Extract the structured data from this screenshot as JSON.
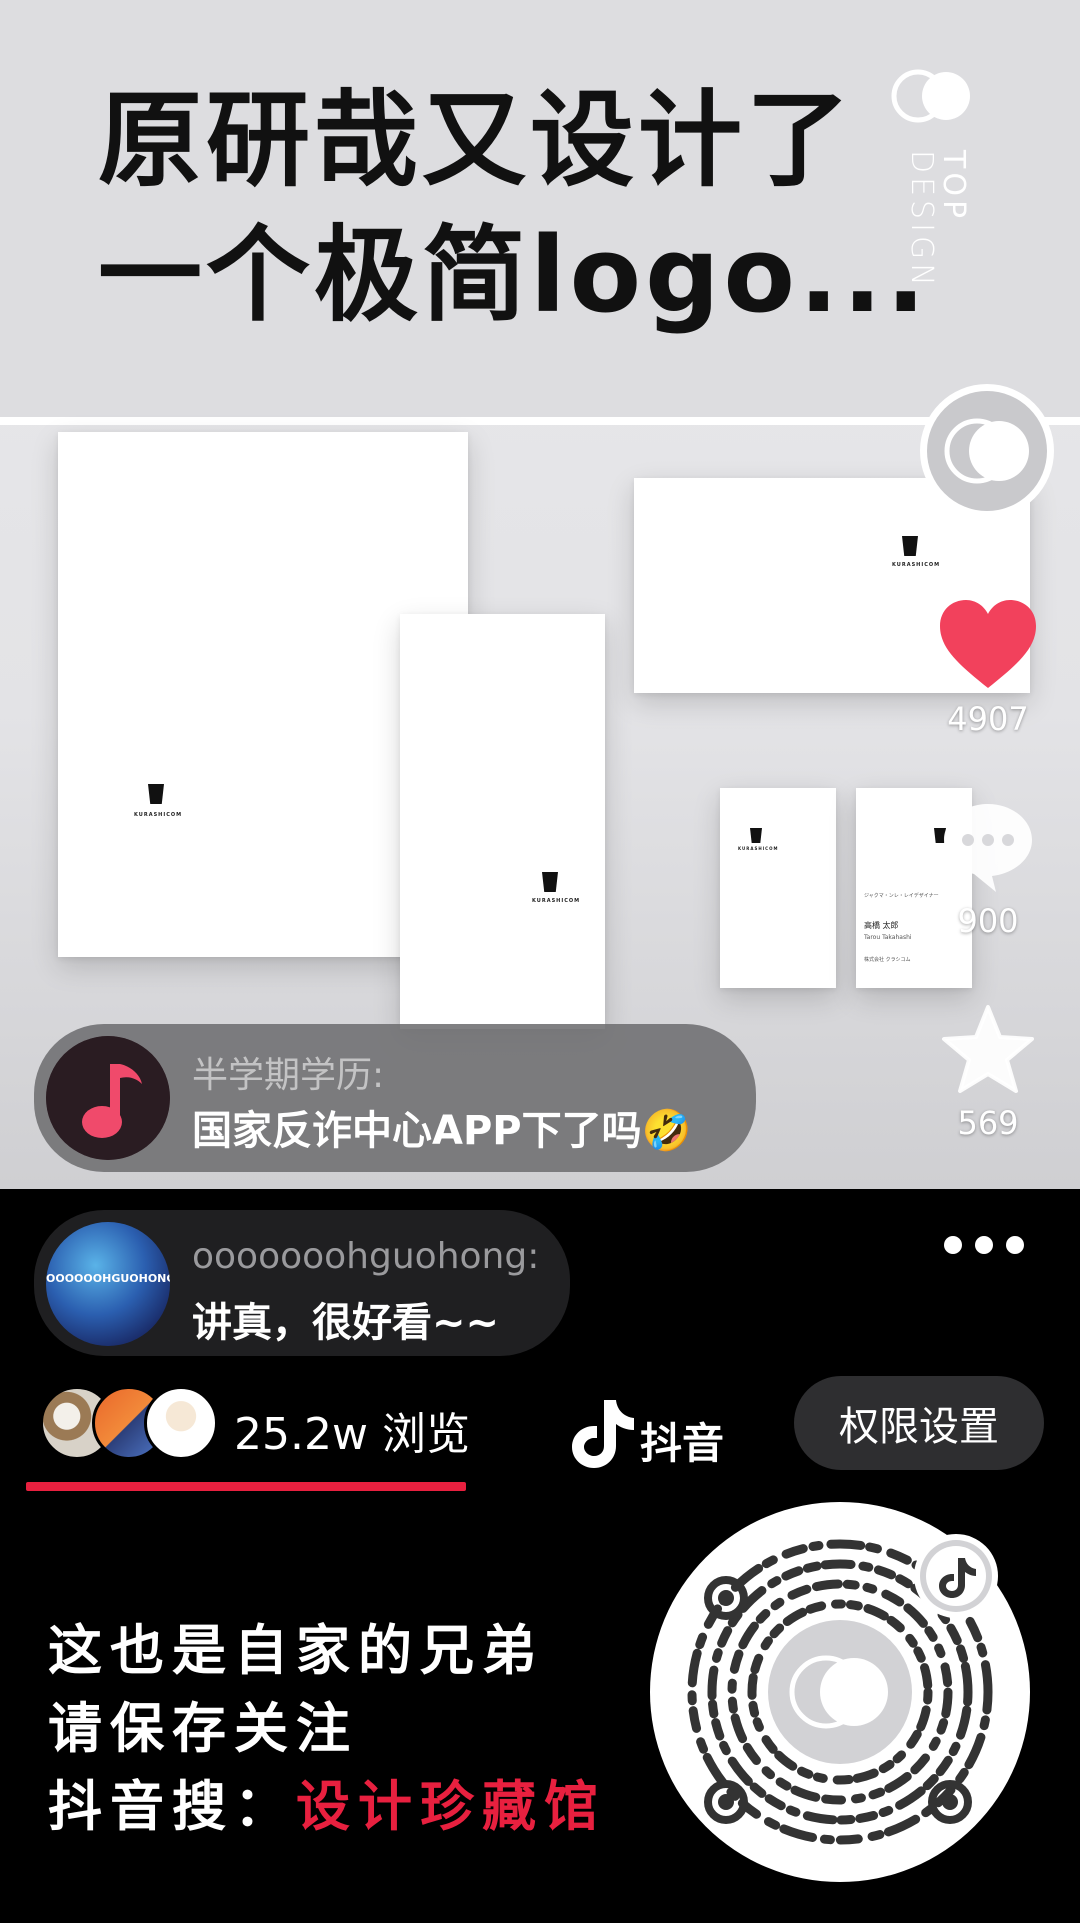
{
  "post": {
    "title_line1": "原研哉又设计了",
    "title_line2": "一个极简logo...",
    "brand_top": "TOP",
    "brand_bottom": "DESIGN",
    "card_brand": "KURASHICOM"
  },
  "business_card": {
    "line1": "ジャクマ・ンレ・レイデザイナー",
    "name_jp": "高橋 太郎",
    "name_en": "Tarou Takahashi",
    "address": "株式会社 クラシコム"
  },
  "actions": {
    "likes": "4907",
    "comments": "900",
    "favorites": "569"
  },
  "danmaku": [
    {
      "user": "半学期学历:",
      "text": "国家反诈中心APP下了吗🤣"
    },
    {
      "user": "ooooooohguohong:",
      "text": "讲真，很好看~~",
      "avatar_text": "OOOOOOHGUOHONG"
    }
  ],
  "stats": {
    "views": "25.2w 浏览"
  },
  "douyin": {
    "label": "抖音"
  },
  "permission_button": "权限设置",
  "promo": {
    "line1": "这也是自家的兄弟",
    "line2": "请保存关注",
    "line3_prefix": "抖音搜：",
    "line3_accent": "设计珍藏馆"
  },
  "colors": {
    "accent_red": "#e8203f",
    "like_red": "#f2415c",
    "bubble_gray": "#6e6e71",
    "dark_pill": "#2e2e30"
  },
  "icons": [
    "brand-logo-icon",
    "heart-icon",
    "comment-icon",
    "star-icon",
    "more-icon",
    "douyin-logo-icon",
    "music-note-icon",
    "qr-code"
  ]
}
